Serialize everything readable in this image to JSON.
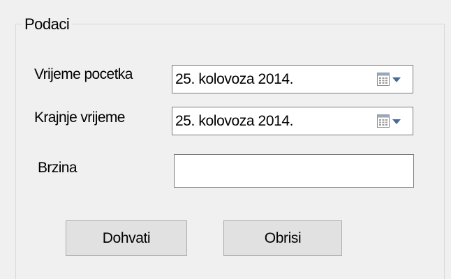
{
  "groupbox": {
    "title": "Podaci"
  },
  "fields": {
    "start_time": {
      "label": "Vrijeme pocetka",
      "value": "25. kolovoza 2014."
    },
    "end_time": {
      "label": "Krajnje vrijeme",
      "value": "25. kolovoza 2014."
    },
    "speed": {
      "label": "Brzina",
      "value": ""
    }
  },
  "buttons": {
    "fetch_label": "Dohvati",
    "delete_label": "Obrisi"
  },
  "icons": {
    "date_picker": "calendar-dropdown-icon"
  },
  "colors": {
    "window_background": "#f0f0f0",
    "input_border": "#7a7a7a",
    "button_background": "#e1e1e1",
    "button_border": "#adadad",
    "dropdown_arrow": "#4a6a95"
  }
}
